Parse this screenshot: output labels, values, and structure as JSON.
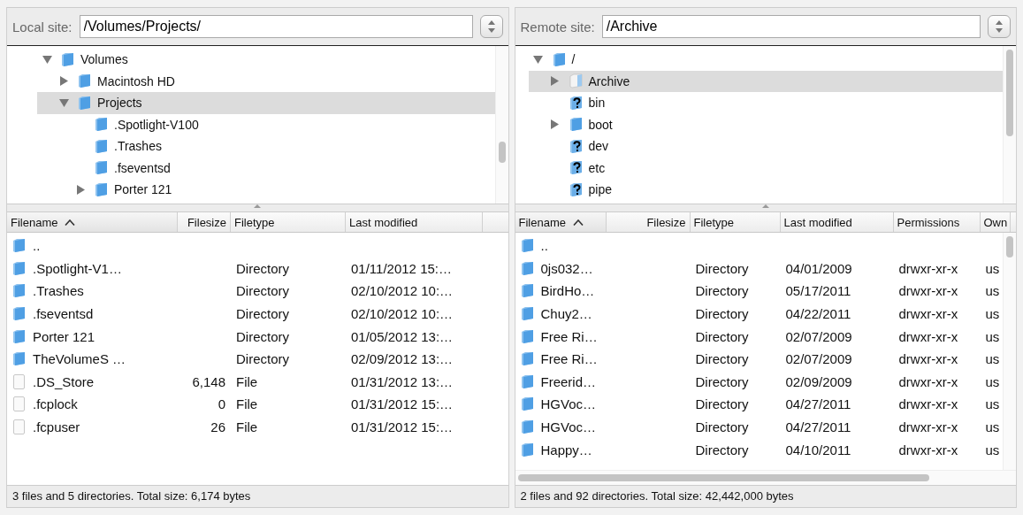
{
  "panes": [
    {
      "site_label": "Local site:",
      "path": "/Volumes/Projects/",
      "tree": [
        {
          "name": "Volumes",
          "kind": "folder",
          "expanded": true,
          "selected": false,
          "children": [
            {
              "name": "Macintosh HD",
              "kind": "folder",
              "expanded": false,
              "selected": false
            },
            {
              "name": "Projects",
              "kind": "folder",
              "expanded": true,
              "selected": true,
              "children": [
                {
                  "name": ".Spotlight-V100",
                  "kind": "folder",
                  "selected": false
                },
                {
                  "name": ".Trashes",
                  "kind": "folder",
                  "selected": false
                },
                {
                  "name": ".fseventsd",
                  "kind": "folder",
                  "selected": false
                },
                {
                  "name": "Porter 121",
                  "kind": "folder",
                  "expanded": false,
                  "selected": false
                }
              ]
            }
          ]
        }
      ],
      "columns": [
        {
          "label": "Filename",
          "sorted": true
        },
        {
          "label": "Filesize"
        },
        {
          "label": "Filetype"
        },
        {
          "label": "Last modified"
        }
      ],
      "rows": [
        {
          "kind": "folder",
          "name": ".."
        },
        {
          "kind": "folder",
          "name": ".Spotlight-V1…",
          "type": "Directory",
          "modified": "01/11/2012 15:…"
        },
        {
          "kind": "folder",
          "name": ".Trashes",
          "type": "Directory",
          "modified": "02/10/2012 10:…"
        },
        {
          "kind": "folder",
          "name": ".fseventsd",
          "type": "Directory",
          "modified": "02/10/2012 10:…"
        },
        {
          "kind": "folder",
          "name": "Porter 121",
          "type": "Directory",
          "modified": "01/05/2012 13:…"
        },
        {
          "kind": "folder",
          "name": "TheVolumeS …",
          "type": "Directory",
          "modified": "02/09/2012 13:…"
        },
        {
          "kind": "file",
          "name": ".DS_Store",
          "size": "6,148",
          "type": "File",
          "modified": "01/31/2012 13:…"
        },
        {
          "kind": "file",
          "name": ".fcplock",
          "size": "0",
          "type": "File",
          "modified": "01/31/2012 15:…"
        },
        {
          "kind": "file",
          "name": ".fcpuser",
          "size": "26",
          "type": "File",
          "modified": "01/31/2012 15:…"
        }
      ],
      "status": "3 files and 5 directories. Total size: 6,174 bytes"
    },
    {
      "site_label": "Remote site:",
      "path": "/Archive",
      "tree": [
        {
          "name": "/",
          "kind": "folder",
          "expanded": true,
          "selected": false,
          "children": [
            {
              "name": "Archive",
              "kind": "link",
              "expanded": false,
              "selected": true
            },
            {
              "name": "bin",
              "kind": "unknown",
              "selected": false
            },
            {
              "name": "boot",
              "kind": "folder",
              "expanded": false,
              "selected": false
            },
            {
              "name": "dev",
              "kind": "unknown",
              "selected": false
            },
            {
              "name": "etc",
              "kind": "unknown",
              "selected": false
            },
            {
              "name": "pipe",
              "kind": "unknown",
              "selected": false
            }
          ]
        }
      ],
      "columns": [
        {
          "label": "Filename",
          "sorted": true
        },
        {
          "label": "Filesize"
        },
        {
          "label": "Filetype"
        },
        {
          "label": "Last modified"
        },
        {
          "label": "Permissions"
        },
        {
          "label": "Own"
        }
      ],
      "rows": [
        {
          "kind": "folder",
          "name": ".."
        },
        {
          "kind": "folder",
          "name": "0js032…",
          "type": "Directory",
          "modified": "04/01/2009",
          "permissions": "drwxr-xr-x",
          "owner": "us"
        },
        {
          "kind": "folder",
          "name": "BirdHo…",
          "type": "Directory",
          "modified": "05/17/2011",
          "permissions": "drwxr-xr-x",
          "owner": "us"
        },
        {
          "kind": "folder",
          "name": "Chuy2…",
          "type": "Directory",
          "modified": "04/22/2011",
          "permissions": "drwxr-xr-x",
          "owner": "us"
        },
        {
          "kind": "folder",
          "name": "Free Ri…",
          "type": "Directory",
          "modified": "02/07/2009",
          "permissions": "drwxr-xr-x",
          "owner": "us"
        },
        {
          "kind": "folder",
          "name": "Free Ri…",
          "type": "Directory",
          "modified": "02/07/2009",
          "permissions": "drwxr-xr-x",
          "owner": "us"
        },
        {
          "kind": "folder",
          "name": "Freerid…",
          "type": "Directory",
          "modified": "02/09/2009",
          "permissions": "drwxr-xr-x",
          "owner": "us"
        },
        {
          "kind": "folder",
          "name": "HGVoc…",
          "type": "Directory",
          "modified": "04/27/2011",
          "permissions": "drwxr-xr-x",
          "owner": "us"
        },
        {
          "kind": "folder",
          "name": "HGVoc…",
          "type": "Directory",
          "modified": "04/27/2011",
          "permissions": "drwxr-xr-x",
          "owner": "us"
        },
        {
          "kind": "folder",
          "name": "Happy…",
          "type": "Directory",
          "modified": "04/10/2011",
          "permissions": "drwxr-xr-x",
          "owner": "us"
        }
      ],
      "status": "2 files and 92 directories. Total size: 42,442,000 bytes"
    }
  ]
}
